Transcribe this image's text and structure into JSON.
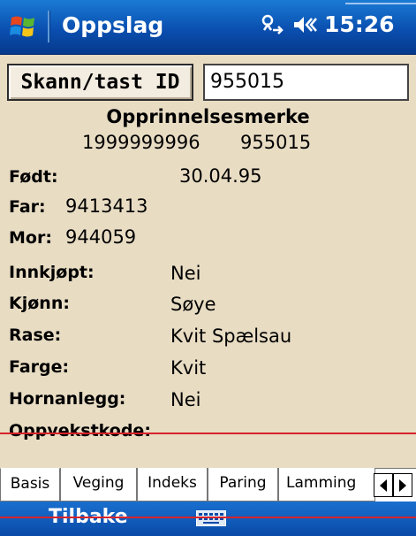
{
  "titlebar": {
    "title": "Oppslag",
    "time": "15:26"
  },
  "scan": {
    "button_label": "Skann/tast ID",
    "id_value": "955015"
  },
  "opprinnelse": {
    "heading": "Opprinnelsesmerke",
    "value1": "1999999996",
    "value2": "955015"
  },
  "fields": {
    "fodt": {
      "label": "Født:",
      "value": "30.04.95"
    },
    "far": {
      "label": "Far:",
      "value": "9413413"
    },
    "mor": {
      "label": "Mor:",
      "value": "944059"
    },
    "innkjopt": {
      "label": "Innkjøpt:",
      "value": "Nei"
    },
    "kjonn": {
      "label": "Kjønn:",
      "value": "Søye"
    },
    "rase": {
      "label": "Rase:",
      "value": "Kvit Spælsau"
    },
    "farge": {
      "label": "Farge:",
      "value": "Kvit"
    },
    "hornanlegg": {
      "label": "Hornanlegg:",
      "value": "Nei"
    },
    "oppvekstkode": {
      "label": "Oppvekstkode:",
      "value": ""
    }
  },
  "tabs": [
    "Basis",
    "Veging",
    "Indeks",
    "Paring",
    "Lamming"
  ],
  "active_tab": "Basis",
  "menubar": {
    "left": "Tilbake",
    "center_icon": "keyboard-icon"
  },
  "colors": {
    "background": "#e8dcc3",
    "titlebar": "#0a4fb0",
    "rule": "#d8232a"
  }
}
